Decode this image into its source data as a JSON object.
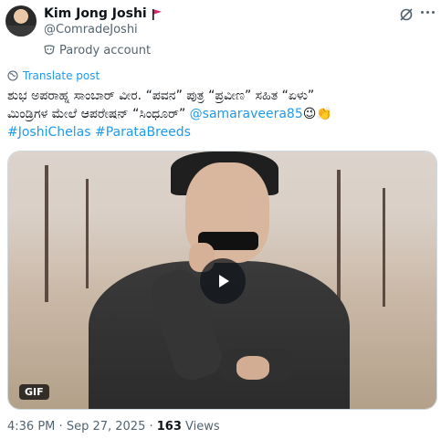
{
  "post": {
    "author": {
      "name": "Kim Jong Joshi",
      "handle": "@ComradeJoshi",
      "label": "Parody account"
    },
    "translate_label": "Translate post",
    "text_line1": "ಶುಭ ಅಪರಾಹ್ನ ಸಾಂಬಾರ್ ವೀರ. “ಪವನ” ಪುತ್ರ “ಪ್ರವೀಣ” ಸಹಿತ “ಏಳು”",
    "text_line2_prefix": "ಮಿಂಡ್ರಿಗಳ ಮೇಲೆ ಆಪರೇಷನ್ “ಸಿಂಧೂರ್” ",
    "mention": "@samaraveera85",
    "emojis": "😉👏",
    "hashtags": [
      "#JoshiChelas",
      "#ParataBreeds"
    ],
    "media": {
      "badge": "GIF"
    },
    "time": "4:36 PM",
    "separator": "·",
    "date": "Sep 27, 2025",
    "views_count": "163",
    "views_label": "Views"
  },
  "colors": {
    "accent": "#1d9bf0",
    "text": "#0f1419",
    "secondary": "#536471",
    "flag": "#e0245e"
  },
  "icons": [
    "flag-icon",
    "parody-mask-icon",
    "grok-icon",
    "more-icon",
    "globe-icon",
    "play-icon"
  ]
}
